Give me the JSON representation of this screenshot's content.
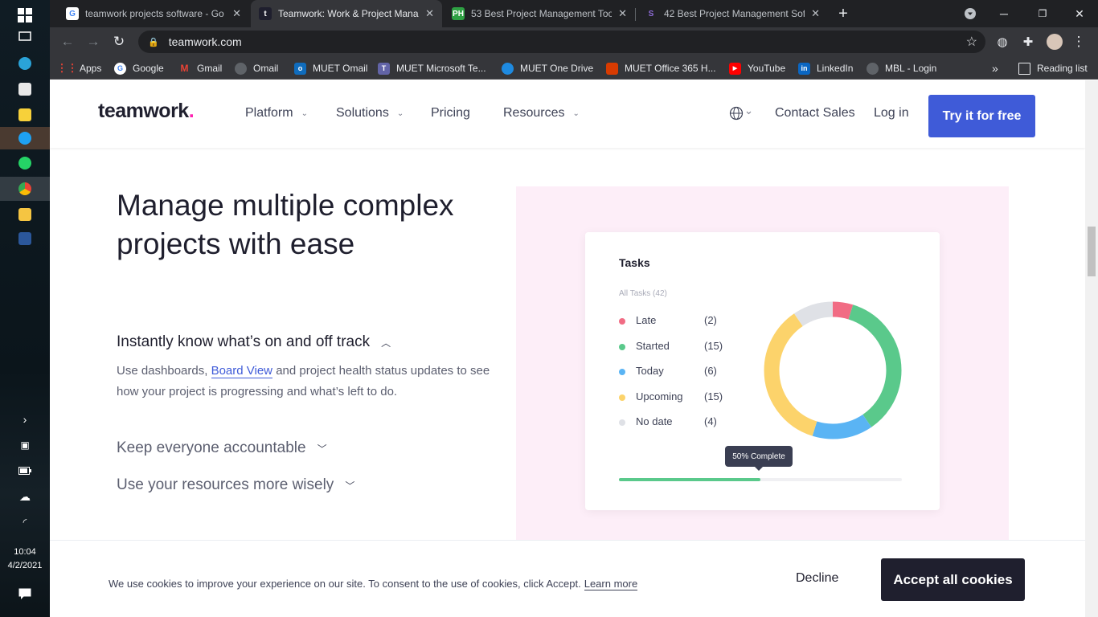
{
  "taskbar": {
    "time": "10:04",
    "date": "4/2/2021"
  },
  "browser": {
    "tabs": [
      {
        "title": "teamwork projects software - Go",
        "active": false
      },
      {
        "title": "Teamwork: Work & Project Mana",
        "active": true
      },
      {
        "title": "53 Best Project Management Too",
        "active": false
      },
      {
        "title": "42 Best Project Management Sof",
        "active": false
      }
    ],
    "url": "teamwork.com",
    "bookmarks": [
      "Apps",
      "Google",
      "Gmail",
      "Omail",
      "MUET Omail",
      "MUET Microsoft Te...",
      "MUET One Drive",
      "MUET Office 365 H...",
      "YouTube",
      "LinkedIn",
      "MBL - Login"
    ],
    "reading_list": "Reading list"
  },
  "site": {
    "logo": "teamwork",
    "logo_dot": ".",
    "nav": [
      "Platform",
      "Solutions",
      "Pricing",
      "Resources"
    ],
    "contact_sales": "Contact Sales",
    "login": "Log in",
    "cta": "Try it for free"
  },
  "hero": {
    "title": "Manage multiple complex projects with ease",
    "accordion": [
      {
        "heading": "Instantly know what’s on and off track",
        "expanded": true
      },
      {
        "heading": "Keep everyone accountable",
        "expanded": false
      },
      {
        "heading": "Use your resources more wisely",
        "expanded": false
      }
    ],
    "body_before": "Use dashboards,",
    "body_link": "Board View",
    "body_after": "and project health status updates to see how your project is progressing and what’s left to do."
  },
  "tasks_card": {
    "title": "Tasks",
    "subtitle": "All Tasks (42)",
    "items": [
      {
        "name": "Late",
        "count": "(2)",
        "value": 2,
        "color": "#f16c84"
      },
      {
        "name": "Started",
        "count": "(15)",
        "value": 15,
        "color": "#5ac98b"
      },
      {
        "name": "Today",
        "count": "(6)",
        "value": 6,
        "color": "#5ab4f4"
      },
      {
        "name": "Upcoming",
        "count": "(15)",
        "value": 15,
        "color": "#fcd36b"
      },
      {
        "name": "No date",
        "count": "(4)",
        "value": 4,
        "color": "#dfe1e6"
      }
    ],
    "progress_label": "50% Complete",
    "progress": 0.5
  },
  "cookie": {
    "text": "We use cookies to improve your experience on our site. To consent to the use of cookies, click Accept.",
    "learn_more": "Learn more",
    "decline": "Decline",
    "accept": "Accept all cookies"
  }
}
